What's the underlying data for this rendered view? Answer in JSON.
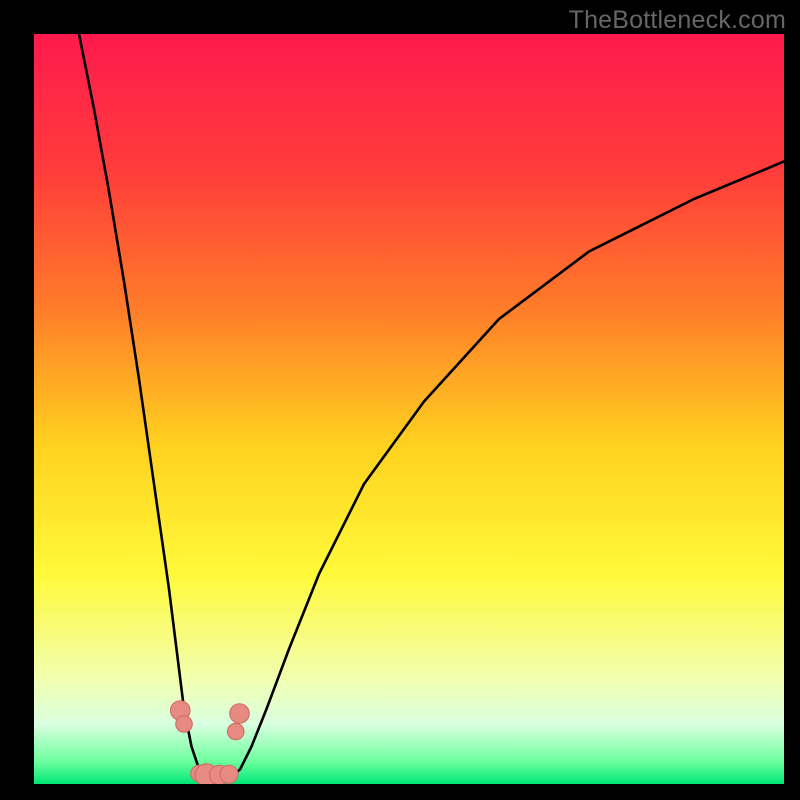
{
  "watermark": "TheBottleneck.com",
  "colors": {
    "frame": "#000000",
    "curve": "#000000",
    "marker_fill": "#e78a82",
    "marker_stroke": "#d46a62",
    "gradient_stops": [
      {
        "offset": 0.0,
        "color": "#ff1a4d"
      },
      {
        "offset": 0.18,
        "color": "#ff3b3b"
      },
      {
        "offset": 0.36,
        "color": "#ff7a2a"
      },
      {
        "offset": 0.55,
        "color": "#ffd21f"
      },
      {
        "offset": 0.72,
        "color": "#fff93a"
      },
      {
        "offset": 0.86,
        "color": "#f2ffb0"
      },
      {
        "offset": 0.92,
        "color": "#d9ffe0"
      },
      {
        "offset": 0.97,
        "color": "#6dff9e"
      },
      {
        "offset": 1.0,
        "color": "#00e676"
      }
    ]
  },
  "chart_data": {
    "type": "line",
    "title": "",
    "xlabel": "",
    "ylabel": "",
    "xlim": [
      0,
      100
    ],
    "ylim": [
      0,
      100
    ],
    "note": "x and y are normalized 0–100 within the gradient plot area; y=0 is top, y=100 is bottom. Values are estimated from pixel positions on the image (no explicit axis ticks shown).",
    "series": [
      {
        "name": "bottleneck-curve",
        "x": [
          6.0,
          8.0,
          10.0,
          12.0,
          14.0,
          16.0,
          18.0,
          19.0,
          20.0,
          21.0,
          22.0,
          23.0,
          24.5,
          26.0,
          27.5,
          29.0,
          31.0,
          34.0,
          38.0,
          44.0,
          52.0,
          62.0,
          74.0,
          88.0,
          100.0
        ],
        "y": [
          0.0,
          10.0,
          21.0,
          33.0,
          46.0,
          60.0,
          74.0,
          82.0,
          90.0,
          95.0,
          98.0,
          99.5,
          99.8,
          99.5,
          98.0,
          95.0,
          90.0,
          82.0,
          72.0,
          60.0,
          49.0,
          38.0,
          29.0,
          22.0,
          17.0
        ]
      }
    ],
    "markers": {
      "name": "highlight-points",
      "note": "Approximate positions of the pink circular markers visible near the curve's minimum.",
      "points": [
        {
          "x": 19.5,
          "y": 90.2,
          "r": 1.3
        },
        {
          "x": 20.0,
          "y": 92.0,
          "r": 1.1
        },
        {
          "x": 22.0,
          "y": 98.6,
          "r": 1.1
        },
        {
          "x": 23.0,
          "y": 98.8,
          "r": 1.5
        },
        {
          "x": 24.7,
          "y": 98.8,
          "r": 1.3
        },
        {
          "x": 26.0,
          "y": 98.7,
          "r": 1.2
        },
        {
          "x": 26.9,
          "y": 93.0,
          "r": 1.1
        },
        {
          "x": 27.4,
          "y": 90.6,
          "r": 1.3
        }
      ]
    }
  }
}
